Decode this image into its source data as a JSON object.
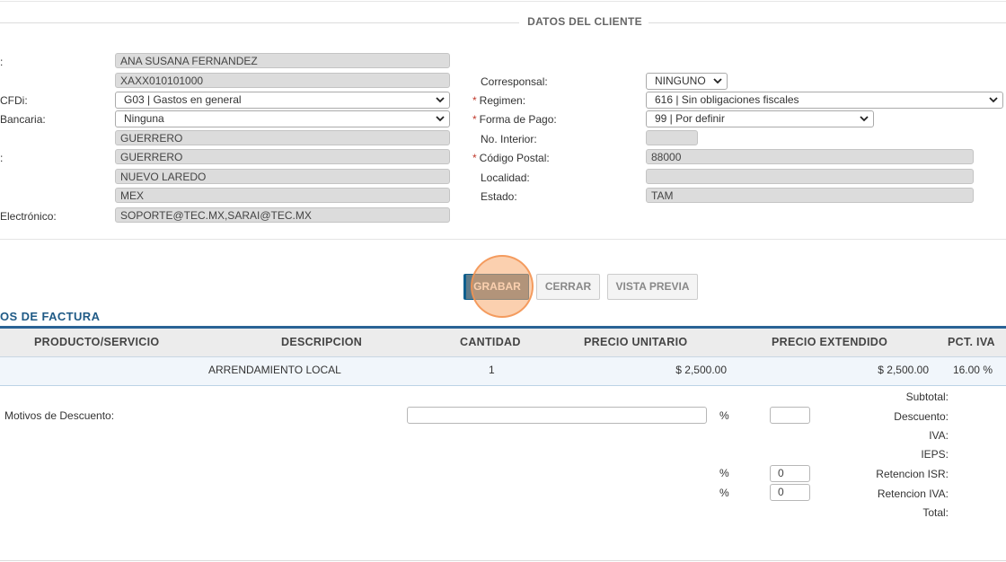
{
  "cliente": {
    "legend": "DATOS DEL CLIENTE",
    "left": [
      {
        "label": ":",
        "value": "ANA SUSANA FERNANDEZ",
        "kind": "ro"
      },
      {
        "label": "",
        "value": "XAXX010101000",
        "kind": "ro"
      },
      {
        "label": "CFDi:",
        "value": "G03 | Gastos en general",
        "kind": "select"
      },
      {
        "label": "Bancaria:",
        "value": "Ninguna",
        "kind": "select"
      },
      {
        "label": "",
        "value": "GUERRERO",
        "kind": "ro"
      },
      {
        "label": ":",
        "value": "GUERRERO",
        "kind": "ro"
      },
      {
        "label": "",
        "value": "NUEVO LAREDO",
        "kind": "ro"
      },
      {
        "label": "",
        "value": "MEX",
        "kind": "ro"
      },
      {
        "label": "Electrónico:",
        "value": "SOPORTE@TEC.MX,SARAI@TEC.MX",
        "kind": "ro"
      }
    ],
    "right": [
      {
        "label": "Corresponsal:",
        "value": "NINGUNO",
        "kind": "select",
        "required": false
      },
      {
        "label": "Regimen:",
        "value": "616 | Sin obligaciones fiscales",
        "kind": "select",
        "required": true
      },
      {
        "label": "Forma de Pago:",
        "value": "99 | Por definir",
        "kind": "select",
        "required": true
      },
      {
        "label": "No. Interior:",
        "value": "",
        "kind": "ro",
        "required": false
      },
      {
        "label": "Código Postal:",
        "value": "88000",
        "kind": "ro",
        "required": true
      },
      {
        "label": "Localidad:",
        "value": "",
        "kind": "ro",
        "required": false
      },
      {
        "label": "Estado:",
        "value": "TAM",
        "kind": "ro",
        "required": false
      }
    ]
  },
  "actions": {
    "grabar": "GRABAR",
    "cerrar": "CERRAR",
    "vista_previa": "VISTA PREVIA"
  },
  "factura": {
    "title": "OS DE FACTURA",
    "headers": {
      "producto": "PRODUCTO/SERVICIO",
      "descripcion": "DESCRIPCION",
      "cantidad": "CANTIDAD",
      "precio_unitario": "PRECIO UNITARIO",
      "precio_extendido": "PRECIO EXTENDIDO",
      "pct_iva": "PCT. IVA"
    },
    "row": {
      "descripcion": "ARRENDAMIENTO LOCAL",
      "cantidad": "1",
      "precio_unitario": "$ 2,500.00",
      "precio_extendido": "$ 2,500.00",
      "pct_iva": "16.00 %"
    }
  },
  "totales": {
    "motivos_label": "Motivos de Descuento:",
    "motivos_value": "",
    "pct_symbol": "%",
    "descuento_pct": "",
    "isr_pct": "0",
    "iva_ret_pct": "0",
    "labels": {
      "subtotal": "Subtotal:",
      "descuento": "Descuento:",
      "iva": "IVA:",
      "ieps": "IEPS:",
      "retencion_isr": "Retencion ISR:",
      "retencion_iva": "Retencion IVA:",
      "total": "Total:"
    }
  }
}
